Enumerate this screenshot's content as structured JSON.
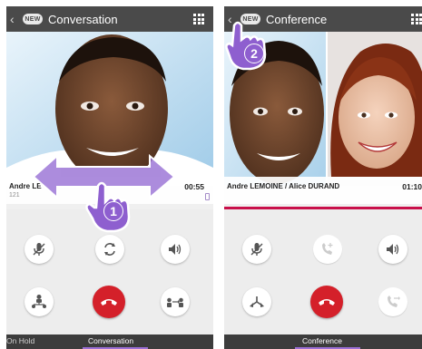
{
  "screens": [
    {
      "title": "Conversation",
      "brand": "NEW",
      "back_glyph": "‹",
      "caller_name": "Andre LE",
      "caller_number": "121",
      "call_time": "00:55",
      "tabs": [
        {
          "label": "On Hold",
          "active": false
        },
        {
          "label": "Conversation",
          "active": true
        }
      ]
    },
    {
      "title": "Conference",
      "brand": "NEW",
      "back_glyph": "‹",
      "caller_name": "Andre LEMOINE / Alice DURAND",
      "call_time": "01:10",
      "tabs": [
        {
          "label": "Conference",
          "active": true
        }
      ]
    }
  ],
  "overlays": {
    "step1": "1",
    "step2": "2"
  },
  "colors": {
    "topbar": "#4a4a4a",
    "accent_line": "#c8104a",
    "hangup": "#d4202a",
    "annotation": "#8e5fcf",
    "tab_underline": "#9b6fd6"
  },
  "icons": {
    "left": [
      "mic-muted-icon",
      "switch-icon",
      "speaker-icon",
      "transfer-icon",
      "hangup-icon",
      "merge-calls-icon"
    ],
    "right": [
      "mic-muted-icon",
      "add-call-icon",
      "speaker-icon",
      "split-icon",
      "hangup-icon",
      "forward-icon"
    ]
  }
}
